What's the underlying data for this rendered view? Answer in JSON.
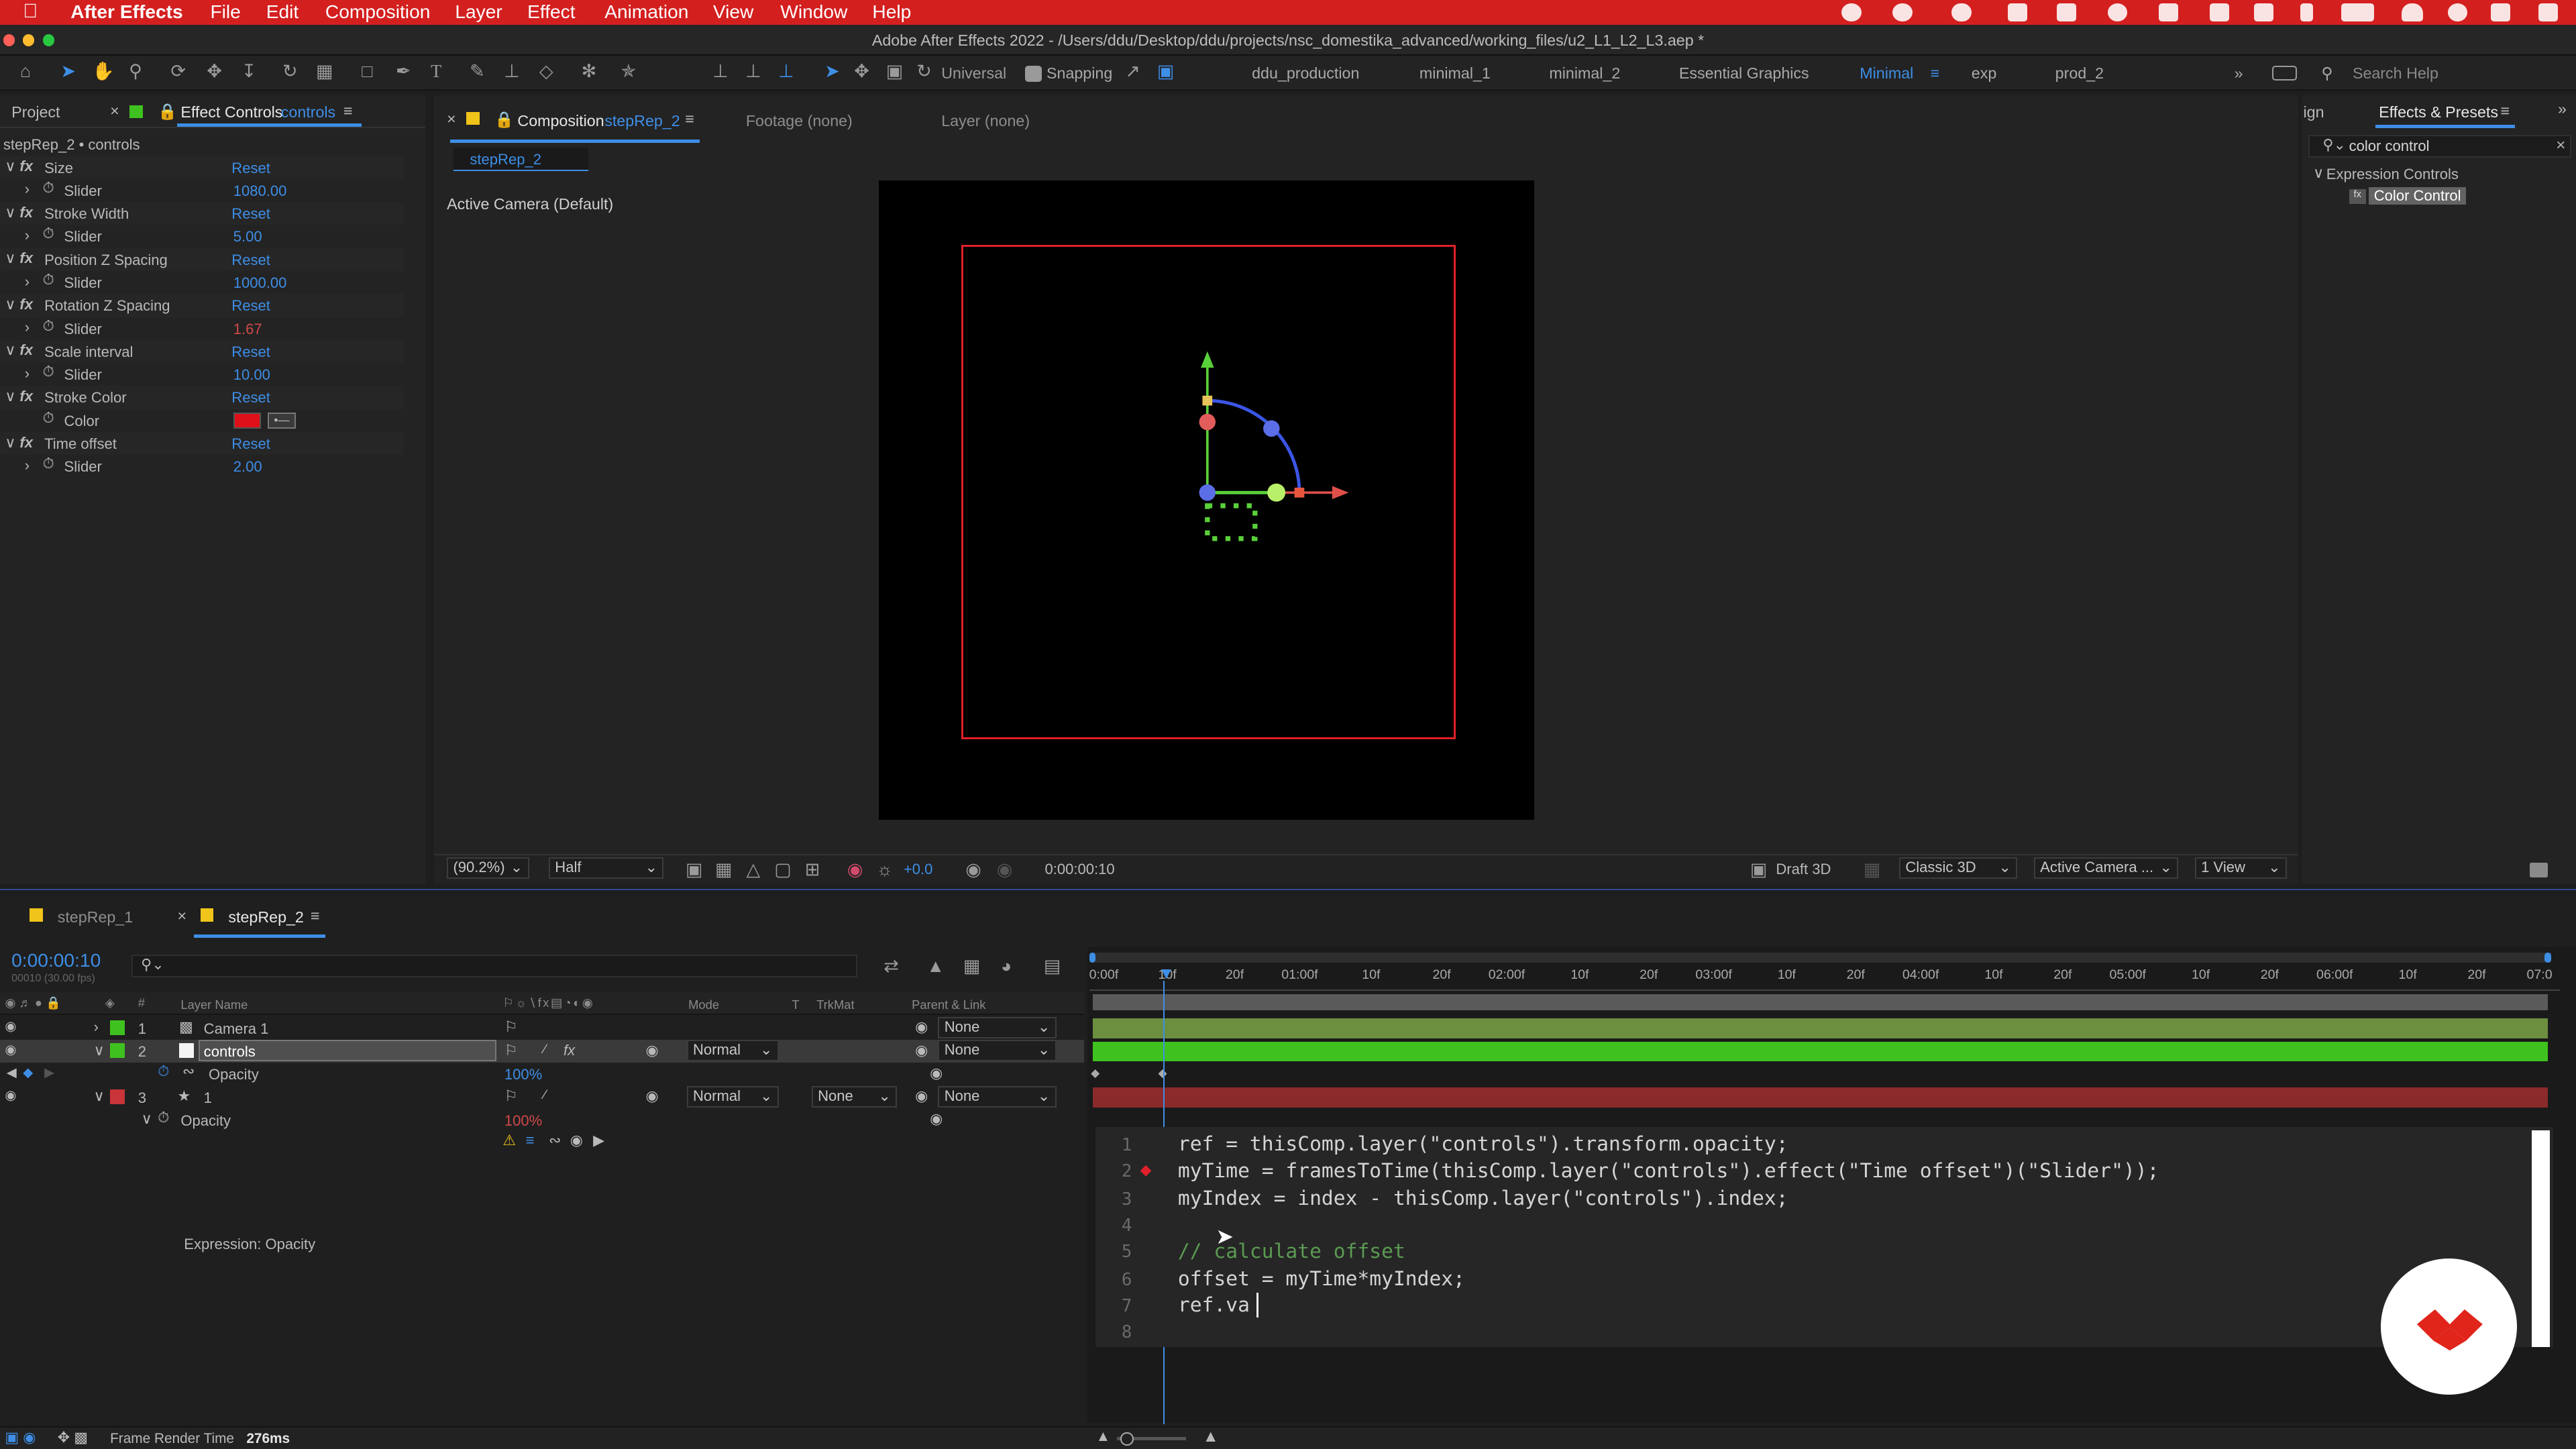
{
  "menubar": {
    "app": "After Effects",
    "items": [
      "File",
      "Edit",
      "Composition",
      "Layer",
      "Effect",
      "Animation",
      "View",
      "Window",
      "Help"
    ]
  },
  "window_title": "Adobe After Effects 2022 - /Users/ddu/Desktop/ddu/projects/nsc_domestika_advanced/working_files/u2_L1_L2_L3.aep *",
  "toolbar": {
    "universal": "Universal",
    "snapping": "Snapping",
    "workspaces": [
      "ddu_production",
      "minimal_1",
      "minimal_2",
      "Essential Graphics",
      "Minimal",
      "exp",
      "prod_2"
    ],
    "active_workspace": "Minimal",
    "search_placeholder": "Search Help"
  },
  "left_panel": {
    "tab_project": "Project",
    "tab_effect_controls": "Effect Controls",
    "tab_layer": "controls",
    "subtitle": "stepRep_2 • controls",
    "effects": [
      {
        "name": "Size",
        "reset": "Reset",
        "prop": "Slider",
        "value": "1080.00"
      },
      {
        "name": "Stroke Width",
        "reset": "Reset",
        "prop": "Slider",
        "value": "5.00"
      },
      {
        "name": "Position Z Spacing",
        "reset": "Reset",
        "prop": "Slider",
        "value": "1000.00"
      },
      {
        "name": "Rotation Z Spacing",
        "reset": "Reset",
        "prop": "Slider",
        "value": "1.67"
      },
      {
        "name": "Scale interval",
        "reset": "Reset",
        "prop": "Slider",
        "value": "10.00"
      },
      {
        "name": "Stroke Color",
        "reset": "Reset",
        "prop": "Color",
        "value": ""
      },
      {
        "name": "Time offset",
        "reset": "Reset",
        "prop": "Slider",
        "value": "2.00"
      }
    ]
  },
  "comp_panel": {
    "tab_label": "Composition",
    "tab_comp": "stepRep_2",
    "footage": "Footage (none)",
    "layer": "Layer (none)",
    "breadcrumb": "stepRep_2",
    "camera_label": "Active Camera (Default)",
    "zoom": "(90.2%)",
    "resolution": "Half",
    "exposure": "+0.0",
    "timecode": "0:00:00:10",
    "draft3d": "Draft 3D",
    "renderer": "Classic 3D",
    "view": "Active Camera ...",
    "views": "1 View"
  },
  "effects_presets": {
    "tab_partial": "ign",
    "title": "Effects & Presets",
    "search_value": "color control",
    "category": "Expression Controls",
    "item": "Color Control"
  },
  "timeline": {
    "tabs": [
      "stepRep_1",
      "stepRep_2"
    ],
    "timecode": "0:00:00:10",
    "fps": "00010 (30.00 fps)",
    "headers": {
      "layer_name": "Layer Name",
      "mode": "Mode",
      "t": "T",
      "trkmat": "TrkMat",
      "parent": "Parent & Link"
    },
    "layers": [
      {
        "num": "1",
        "name": "Camera 1",
        "mode": "",
        "trkmat": "",
        "parent": "None"
      },
      {
        "num": "2",
        "name": "controls",
        "mode": "Normal",
        "trkmat": "",
        "parent": "None"
      },
      {
        "num": "",
        "name": "Opacity",
        "mode": "",
        "trkmat": "",
        "parent": "",
        "value": "100%"
      },
      {
        "num": "3",
        "name": "1",
        "mode": "Normal",
        "trkmat": "None",
        "parent": "None"
      },
      {
        "num": "",
        "name": "Opacity",
        "mode": "",
        "trkmat": "",
        "parent": "",
        "value": "100%"
      }
    ],
    "expression_label": "Expression: Opacity",
    "ruler": [
      "0:00f",
      "10f",
      "20f",
      "01:00f",
      "10f",
      "20f",
      "02:00f",
      "10f",
      "20f",
      "03:00f",
      "10f",
      "20f",
      "04:00f",
      "10f",
      "20f",
      "05:00f",
      "10f",
      "20f",
      "06:00f",
      "10f",
      "20f",
      "07:0"
    ]
  },
  "expression_code": [
    "ref = thisComp.layer(\"controls\").transform.opacity;",
    "myTime = framesToTime(thisComp.layer(\"controls\").effect(\"Time offset\")(\"Slider\"));",
    "myIndex = index - thisComp.layer(\"controls\").index;",
    "",
    "// calculate offset",
    "offset = myTime*myIndex;",
    "ref.va",
    ""
  ],
  "status": {
    "label": "Frame Render Time",
    "value": "276ms"
  },
  "colors": {
    "accent": "#d41f1f",
    "blue": "#3e8ee6",
    "green_bar": "#3fc21f",
    "red_bar": "#8b2a2a",
    "stroke_color": "#e0101a"
  }
}
